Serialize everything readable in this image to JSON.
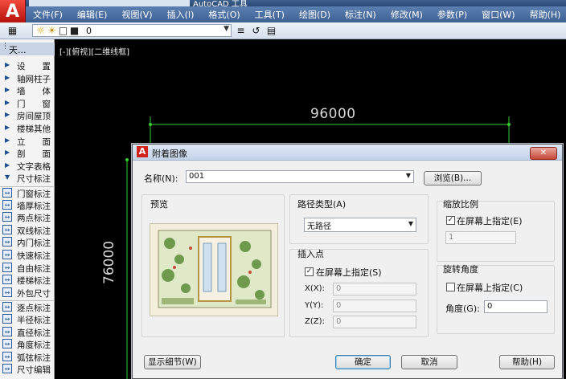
{
  "app": {
    "title": "AutoCAD 工具",
    "logo_letter": "A"
  },
  "menubar": {
    "items": [
      "文件(F)",
      "编辑(E)",
      "视图(V)",
      "插入(I)",
      "格式(O)",
      "工具(T)",
      "绘图(D)",
      "标注(N)",
      "修改(M)",
      "参数(P)",
      "窗口(W)",
      "帮助(H)"
    ]
  },
  "toolbar": {
    "layer_value": "0"
  },
  "palette": {
    "header": "天...",
    "items": [
      "设　　置",
      "轴网柱子",
      "墙　　体",
      "门　　窗",
      "房间屋顶",
      "楼梯其他",
      "立　　面",
      "剖　　面",
      "文字表格",
      "尺寸标注",
      "门窗标注",
      "墙厚标注",
      "两点标注",
      "双线标注",
      "内门标注",
      "快速标注",
      "自由标注",
      "楼梯标注",
      "外包尺寸",
      "逐点标注",
      "半径标注",
      "直径标注",
      "角度标注",
      "弧弦标注",
      "尺寸编辑"
    ]
  },
  "canvas": {
    "view_label": "[-][俯视][二维线框]",
    "dim_horizontal": "96000",
    "dim_vertical": "76000"
  },
  "dialog": {
    "title": "附着图像",
    "close_icon": "close-icon",
    "name_label": "名称(N):",
    "name_value": "001",
    "browse_label": "浏览(B)...",
    "preview_label": "预览",
    "path_type_label": "路径类型(A)",
    "path_type_value": "无路径",
    "insert_point_label": "插入点",
    "insert_specify_label": "在屏幕上指定(S)",
    "insert_specify_checked": true,
    "x_label": "X(X):",
    "x_value": "0",
    "y_label": "Y(Y):",
    "y_value": "0",
    "z_label": "Z(Z):",
    "z_value": "0",
    "scale_label": "缩放比例",
    "scale_specify_label": "在屏幕上指定(E)",
    "scale_specify_checked": true,
    "scale_value": "1",
    "rotation_label": "旋转角度",
    "rotation_specify_label": "在屏幕上指定(C)",
    "rotation_specify_checked": false,
    "angle_label": "角度(G):",
    "angle_value": "0",
    "details_label": "显示细节(W)",
    "ok_label": "确定",
    "cancel_label": "取消",
    "help_label": "帮助(H)"
  },
  "colors": {
    "canvas_bg": "#000000",
    "dimension_line": "#33cc33",
    "menubar": "#3d6293",
    "close_button": "#c7473a"
  }
}
